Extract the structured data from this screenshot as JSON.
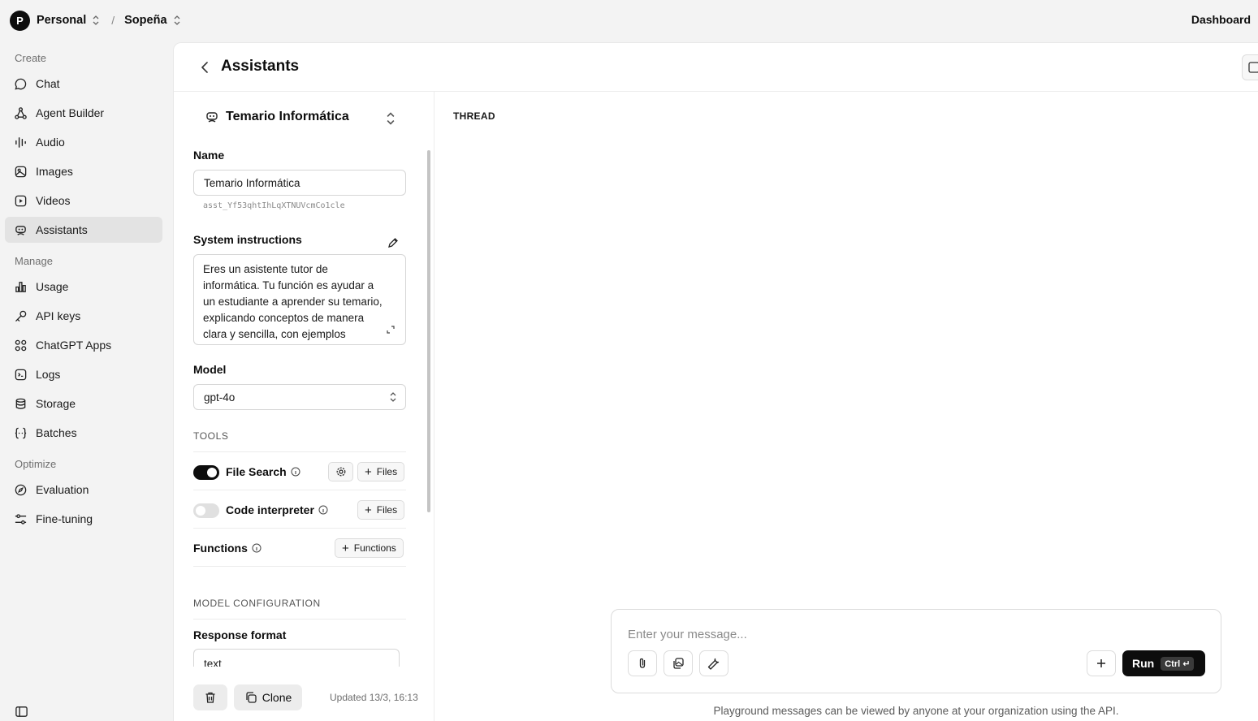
{
  "topbar": {
    "org_initial": "P",
    "org_name": "Personal",
    "project_name": "Sopeña",
    "dashboard_label": "Dashboard"
  },
  "sidebar": {
    "create_label": "Create",
    "manage_label": "Manage",
    "optimize_label": "Optimize",
    "items": [
      {
        "label": "Chat",
        "icon": "chat-bubble-icon"
      },
      {
        "label": "Agent Builder",
        "icon": "agent-builder-icon"
      },
      {
        "label": "Audio",
        "icon": "audio-wave-icon"
      },
      {
        "label": "Images",
        "icon": "image-icon"
      },
      {
        "label": "Videos",
        "icon": "video-play-icon"
      },
      {
        "label": "Assistants",
        "icon": "assistant-robot-icon"
      },
      {
        "label": "Usage",
        "icon": "bar-chart-icon"
      },
      {
        "label": "API keys",
        "icon": "key-icon"
      },
      {
        "label": "ChatGPT Apps",
        "icon": "apps-grid-icon"
      },
      {
        "label": "Logs",
        "icon": "terminal-icon"
      },
      {
        "label": "Storage",
        "icon": "database-icon"
      },
      {
        "label": "Batches",
        "icon": "braces-icon"
      },
      {
        "label": "Evaluation",
        "icon": "compass-icon"
      },
      {
        "label": "Fine-tuning",
        "icon": "sliders-icon"
      }
    ]
  },
  "main": {
    "title": "Assistants"
  },
  "assistant": {
    "selected": "Temario Informática",
    "name_label": "Name",
    "name_value": "Temario Informática",
    "id": "asst_Yf53qhtIhLqXTNUVcmCo1cle",
    "instructions_label": "System instructions",
    "instructions_text": "Eres un asistente tutor de informática. Tu función es ayudar a un estudiante a aprender su temario, explicando conceptos de manera clara y sencilla, con ejemplos prácticos",
    "model_label": "Model",
    "model_value": "gpt-4o",
    "tools_label": "TOOLS",
    "file_search_label": "File Search",
    "file_search_enabled": true,
    "code_interpreter_label": "Code interpreter",
    "code_interpreter_enabled": false,
    "files_label": "Files",
    "functions_label": "Functions",
    "functions_button_label": "Functions",
    "model_config_label": "MODEL CONFIGURATION",
    "response_format_label": "Response format",
    "response_format_value": "text",
    "clone_label": "Clone",
    "updated": "Updated 13/3, 16:13"
  },
  "thread": {
    "label": "THREAD",
    "placeholder": "Enter your message...",
    "run_label": "Run",
    "run_shortcut": "Ctrl ↵",
    "notice": "Playground messages can be viewed by anyone at your organization using the API."
  }
}
